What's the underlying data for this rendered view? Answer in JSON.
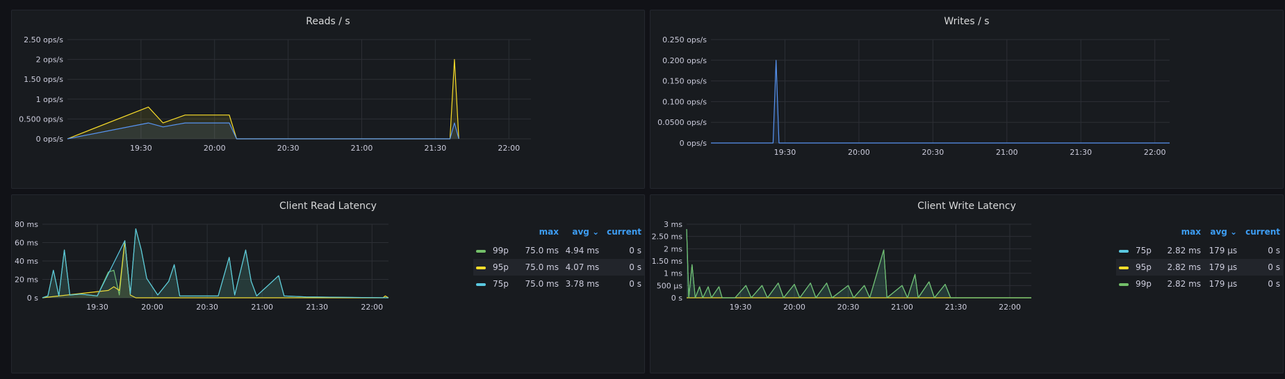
{
  "panels": {
    "reads": {
      "title": "Reads / s",
      "y_ticks": [
        "2.50 ops/s",
        "2 ops/s",
        "1.50 ops/s",
        "1 ops/s",
        "0.500 ops/s",
        "0 ops/s"
      ],
      "x_ticks": [
        "19:30",
        "20:00",
        "20:30",
        "21:00",
        "21:30",
        "22:00"
      ]
    },
    "writes": {
      "title": "Writes / s",
      "y_ticks": [
        "0.250 ops/s",
        "0.200 ops/s",
        "0.150 ops/s",
        "0.100 ops/s",
        "0.0500 ops/s",
        "0 ops/s"
      ],
      "x_ticks": [
        "19:30",
        "20:00",
        "20:30",
        "21:00",
        "21:30",
        "22:00"
      ]
    },
    "read_latency": {
      "title": "Client Read Latency",
      "y_ticks": [
        "80 ms",
        "60 ms",
        "40 ms",
        "20 ms",
        "0 s"
      ],
      "x_ticks": [
        "19:30",
        "20:00",
        "20:30",
        "21:00",
        "21:30",
        "22:00"
      ],
      "legend_headers": {
        "max": "max",
        "avg": "avg",
        "current": "current"
      },
      "legend": [
        {
          "name": "99p",
          "max": "75.0 ms",
          "avg": "4.94 ms",
          "current": "0 s",
          "color": "#73bf69"
        },
        {
          "name": "95p",
          "max": "75.0 ms",
          "avg": "4.07 ms",
          "current": "0 s",
          "color": "#fade2a"
        },
        {
          "name": "75p",
          "max": "75.0 ms",
          "avg": "3.78 ms",
          "current": "0 s",
          "color": "#5ac8e0"
        }
      ]
    },
    "write_latency": {
      "title": "Client Write Latency",
      "y_ticks": [
        "3 ms",
        "2.50 ms",
        "2 ms",
        "1.50 ms",
        "1 ms",
        "500 µs",
        "0 s"
      ],
      "x_ticks": [
        "19:30",
        "20:00",
        "20:30",
        "21:00",
        "21:30",
        "22:00"
      ],
      "legend_headers": {
        "max": "max",
        "avg": "avg",
        "current": "current"
      },
      "legend": [
        {
          "name": "75p",
          "max": "2.82 ms",
          "avg": "179 µs",
          "current": "0 s",
          "color": "#5ac8e0"
        },
        {
          "name": "95p",
          "max": "2.82 ms",
          "avg": "179 µs",
          "current": "0 s",
          "color": "#fade2a"
        },
        {
          "name": "99p",
          "max": "2.82 ms",
          "avg": "179 µs",
          "current": "0 s",
          "color": "#73bf69"
        }
      ]
    }
  },
  "chart_data": [
    {
      "type": "line",
      "title": "Reads / s",
      "ylabel": "ops/s",
      "ylim": [
        0,
        2.5
      ],
      "series": [
        {
          "color": "#fade2a",
          "points": [
            [
              19.0,
              0
            ],
            [
              19.55,
              0.8
            ],
            [
              19.65,
              0.4
            ],
            [
              19.8,
              0.6
            ],
            [
              20.1,
              0.6
            ],
            [
              20.15,
              0
            ],
            [
              21.6,
              0
            ],
            [
              21.63,
              2.0
            ],
            [
              21.66,
              0
            ]
          ]
        },
        {
          "color": "#5794f2",
          "points": [
            [
              19.0,
              0
            ],
            [
              19.55,
              0.4
            ],
            [
              19.65,
              0.3
            ],
            [
              19.8,
              0.4
            ],
            [
              20.1,
              0.4
            ],
            [
              20.15,
              0
            ],
            [
              21.6,
              0
            ],
            [
              21.63,
              0.4
            ],
            [
              21.66,
              0
            ]
          ]
        }
      ]
    },
    {
      "type": "line",
      "title": "Writes / s",
      "ylabel": "ops/s",
      "ylim": [
        0,
        0.25
      ],
      "series": [
        {
          "color": "#5794f2",
          "points": [
            [
              19.0,
              0
            ],
            [
              19.42,
              0
            ],
            [
              19.44,
              0.2
            ],
            [
              19.46,
              0
            ],
            [
              22.1,
              0
            ]
          ]
        }
      ]
    },
    {
      "type": "line",
      "title": "Client Read Latency",
      "ylabel": "ms",
      "ylim": [
        0,
        80
      ],
      "series": [
        {
          "name": "99p",
          "color": "#73bf69",
          "points": [
            [
              19.0,
              0
            ],
            [
              19.05,
              2
            ],
            [
              19.1,
              30
            ],
            [
              19.15,
              2
            ],
            [
              19.2,
              52
            ],
            [
              19.25,
              3
            ],
            [
              19.35,
              4
            ],
            [
              19.5,
              2
            ],
            [
              19.6,
              28
            ],
            [
              19.65,
              30
            ],
            [
              19.7,
              3
            ],
            [
              19.75,
              62
            ],
            [
              19.8,
              4
            ],
            [
              19.85,
              75
            ],
            [
              19.9,
              52
            ],
            [
              19.95,
              21
            ],
            [
              20.05,
              3
            ],
            [
              20.15,
              18
            ],
            [
              20.2,
              36
            ],
            [
              20.25,
              2
            ],
            [
              20.6,
              2
            ],
            [
              20.7,
              44
            ],
            [
              20.75,
              3
            ],
            [
              20.85,
              52
            ],
            [
              20.9,
              18
            ],
            [
              20.95,
              2
            ],
            [
              21.15,
              24
            ],
            [
              21.2,
              2
            ],
            [
              21.4,
              1
            ],
            [
              22.15,
              0
            ]
          ]
        },
        {
          "name": "95p",
          "color": "#fade2a",
          "points": [
            [
              19.0,
              0
            ],
            [
              19.6,
              8
            ],
            [
              19.65,
              12
            ],
            [
              19.7,
              8
            ],
            [
              19.75,
              62
            ],
            [
              19.8,
              3
            ],
            [
              19.85,
              0
            ],
            [
              22.1,
              0
            ],
            [
              22.12,
              2
            ],
            [
              22.15,
              0
            ]
          ]
        },
        {
          "name": "75p",
          "color": "#5ac8e0",
          "points": [
            [
              19.0,
              0
            ],
            [
              19.05,
              2
            ],
            [
              19.1,
              30
            ],
            [
              19.15,
              2
            ],
            [
              19.2,
              52
            ],
            [
              19.25,
              3
            ],
            [
              19.35,
              4
            ],
            [
              19.5,
              2
            ],
            [
              19.75,
              62
            ],
            [
              19.8,
              4
            ],
            [
              19.85,
              75
            ],
            [
              19.9,
              52
            ],
            [
              19.95,
              21
            ],
            [
              20.05,
              3
            ],
            [
              20.15,
              18
            ],
            [
              20.2,
              36
            ],
            [
              20.25,
              2
            ],
            [
              20.6,
              2
            ],
            [
              20.7,
              44
            ],
            [
              20.75,
              3
            ],
            [
              20.85,
              52
            ],
            [
              20.9,
              18
            ],
            [
              20.95,
              2
            ],
            [
              21.15,
              24
            ],
            [
              21.2,
              2
            ],
            [
              21.4,
              1
            ],
            [
              22.15,
              0
            ]
          ]
        }
      ]
    },
    {
      "type": "line",
      "title": "Client Write Latency",
      "ylabel": "ms",
      "ylim": [
        0,
        3
      ],
      "series": [
        {
          "name": "75p",
          "color": "#5ac8e0",
          "points": [
            [
              19.0,
              2.8
            ],
            [
              19.02,
              0
            ],
            [
              19.05,
              1.35
            ],
            [
              19.08,
              0
            ],
            [
              19.12,
              0.45
            ],
            [
              19.15,
              0
            ],
            [
              19.2,
              0.45
            ],
            [
              19.23,
              0
            ],
            [
              19.3,
              0.45
            ],
            [
              19.33,
              0
            ],
            [
              19.45,
              0
            ],
            [
              19.55,
              0.5
            ],
            [
              19.6,
              0
            ],
            [
              19.7,
              0.5
            ],
            [
              19.75,
              0
            ],
            [
              19.85,
              0.6
            ],
            [
              19.9,
              0
            ],
            [
              20.0,
              0.55
            ],
            [
              20.05,
              0
            ],
            [
              20.15,
              0.6
            ],
            [
              20.2,
              0
            ],
            [
              20.3,
              0.6
            ],
            [
              20.35,
              0
            ],
            [
              20.5,
              0.5
            ],
            [
              20.55,
              0
            ],
            [
              20.65,
              0.5
            ],
            [
              20.7,
              0
            ],
            [
              20.83,
              1.95
            ],
            [
              20.86,
              0
            ],
            [
              21.0,
              0.5
            ],
            [
              21.05,
              0
            ],
            [
              21.12,
              0.95
            ],
            [
              21.15,
              0
            ],
            [
              21.25,
              0.65
            ],
            [
              21.3,
              0
            ],
            [
              21.4,
              0.55
            ],
            [
              21.45,
              0
            ],
            [
              21.55,
              0
            ],
            [
              22.2,
              0
            ]
          ]
        },
        {
          "name": "95p",
          "color": "#fade2a",
          "points": [
            [
              19.0,
              0
            ],
            [
              22.2,
              0
            ]
          ]
        },
        {
          "name": "99p",
          "color": "#73bf69",
          "points": [
            [
              19.0,
              2.8
            ],
            [
              19.02,
              0
            ],
            [
              19.05,
              1.35
            ],
            [
              19.08,
              0
            ],
            [
              19.12,
              0.45
            ],
            [
              19.15,
              0
            ],
            [
              19.2,
              0.45
            ],
            [
              19.23,
              0
            ],
            [
              19.3,
              0.45
            ],
            [
              19.33,
              0
            ],
            [
              19.45,
              0
            ],
            [
              19.55,
              0.5
            ],
            [
              19.6,
              0
            ],
            [
              19.7,
              0.5
            ],
            [
              19.75,
              0
            ],
            [
              19.85,
              0.6
            ],
            [
              19.9,
              0
            ],
            [
              20.0,
              0.55
            ],
            [
              20.05,
              0
            ],
            [
              20.15,
              0.6
            ],
            [
              20.2,
              0
            ],
            [
              20.3,
              0.6
            ],
            [
              20.35,
              0
            ],
            [
              20.5,
              0.5
            ],
            [
              20.55,
              0
            ],
            [
              20.65,
              0.5
            ],
            [
              20.7,
              0
            ],
            [
              20.83,
              1.95
            ],
            [
              20.86,
              0
            ],
            [
              21.0,
              0.5
            ],
            [
              21.05,
              0
            ],
            [
              21.12,
              0.95
            ],
            [
              21.15,
              0
            ],
            [
              21.25,
              0.65
            ],
            [
              21.3,
              0
            ],
            [
              21.4,
              0.55
            ],
            [
              21.45,
              0
            ],
            [
              21.55,
              0
            ],
            [
              22.2,
              0
            ]
          ]
        }
      ]
    }
  ]
}
